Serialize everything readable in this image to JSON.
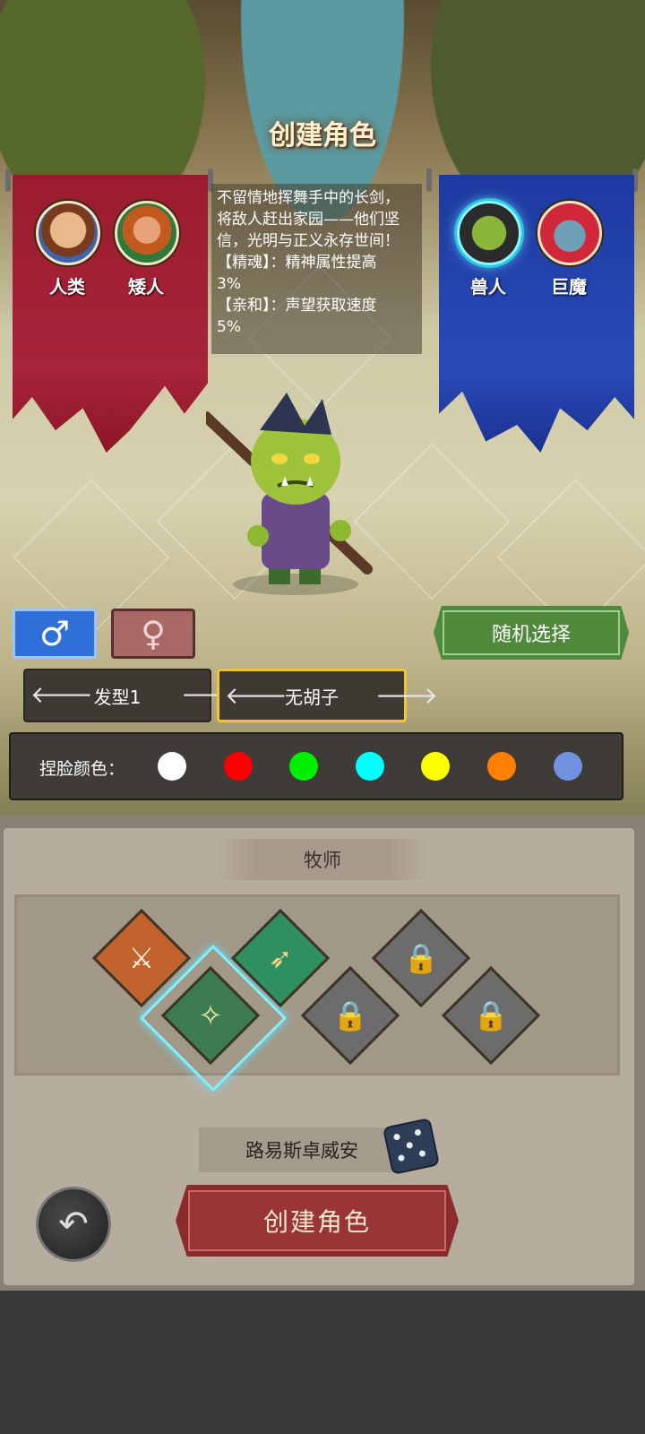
{
  "title": "创建角色",
  "races_left": [
    {
      "label": "人类",
      "icon": "human-portrait-icon"
    },
    {
      "label": "矮人",
      "icon": "dwarf-portrait-icon"
    }
  ],
  "races_right": [
    {
      "label": "兽人",
      "icon": "orc-portrait-icon",
      "selected": true
    },
    {
      "label": "巨魔",
      "icon": "troll-portrait-icon"
    }
  ],
  "description": [
    "不留情地挥舞手中的长剑，",
    "将敌人赶出家园——他们坚",
    "信，光明与正义永存世间！",
    "【精魂】：精神属性提高",
    "3%",
    "【亲和】：声望获取速度",
    "5%"
  ],
  "gender": {
    "male_symbol": "♂",
    "female_symbol": "♀",
    "selected": "male"
  },
  "random_button": "随机选择",
  "hair": {
    "value": "发型1",
    "prev": "🡐",
    "next": "🡒"
  },
  "beard": {
    "value": "无胡子",
    "prev": "🡐",
    "next": "🡒"
  },
  "face_color": {
    "label": "捏脸颜色：",
    "colors": [
      "#ffffff",
      "#ff0000",
      "#00ee00",
      "#00ffff",
      "#ffff00",
      "#ff8000",
      "#7090e0"
    ]
  },
  "class_name": "牧师",
  "classes": [
    {
      "icon": "sword-class-icon",
      "locked": false
    },
    {
      "icon": "priest-class-icon",
      "locked": false,
      "selected": true
    },
    {
      "icon": "crossbow-class-icon",
      "locked": false
    },
    {
      "icon": "locked-totem-class-icon",
      "locked": true
    },
    {
      "icon": "locked-hat-class-icon",
      "locked": true
    },
    {
      "icon": "locked-shaman-class-icon",
      "locked": true
    }
  ],
  "character_name": "路易斯卓威安",
  "create_button": "创建角色",
  "back_symbol": "↶"
}
